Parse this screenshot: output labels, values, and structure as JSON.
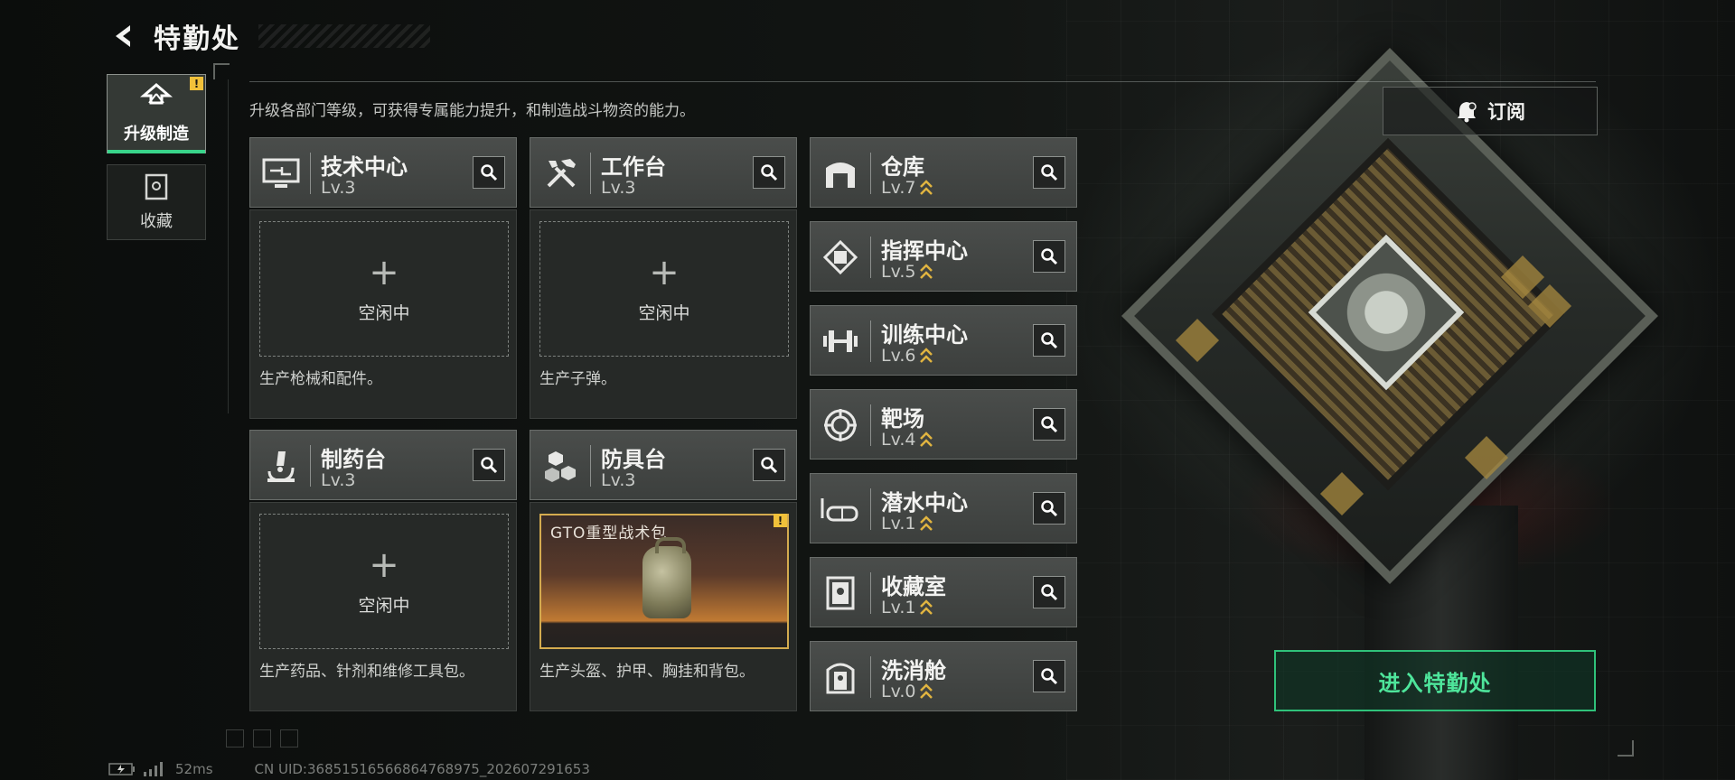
{
  "header": {
    "title": "特勤处",
    "back_icon": "back-arrow-icon"
  },
  "side_tabs": [
    {
      "label": "升级制造",
      "icon": "upgrade-arrow-icon",
      "active": true,
      "badge": "!"
    },
    {
      "label": "收藏",
      "icon": "collection-case-icon",
      "active": false
    }
  ],
  "intro_text": "升级各部门等级，可获得专属能力提升，和制造战斗物资的能力。",
  "production_cards": [
    {
      "name": "技术中心",
      "level": "Lv.3",
      "icon": "monitor-icon",
      "slot_status": "空闲中",
      "slot_plus": "+",
      "desc": "生产枪械和配件。"
    },
    {
      "name": "工作台",
      "level": "Lv.3",
      "icon": "tools-icon",
      "slot_status": "空闲中",
      "slot_plus": "+",
      "desc": "生产子弹。"
    },
    {
      "name": "制药台",
      "level": "Lv.3",
      "icon": "microscope-icon",
      "slot_status": "空闲中",
      "slot_plus": "+",
      "desc": "生产药品、针剂和维修工具包。"
    },
    {
      "name": "防具台",
      "level": "Lv.3",
      "icon": "armor-blocks-icon",
      "product_name": "GTO重型战术包",
      "product_badge": "!",
      "desc": "生产头盔、护甲、胸挂和背包。"
    }
  ],
  "facilities": [
    {
      "name": "仓库",
      "level": "Lv.7",
      "icon": "warehouse-icon",
      "upgradeable": true
    },
    {
      "name": "指挥中心",
      "level": "Lv.5",
      "icon": "chip-icon",
      "upgradeable": true
    },
    {
      "name": "训练中心",
      "level": "Lv.6",
      "icon": "dumbbell-icon",
      "upgradeable": true
    },
    {
      "name": "靶场",
      "level": "Lv.4",
      "icon": "target-icon",
      "upgradeable": true
    },
    {
      "name": "潜水中心",
      "level": "Lv.1",
      "icon": "diving-mask-icon",
      "upgradeable": true
    },
    {
      "name": "收藏室",
      "level": "Lv.1",
      "icon": "display-case-icon",
      "upgradeable": true
    },
    {
      "name": "洗消舱",
      "level": "Lv.0",
      "icon": "decon-pod-icon",
      "upgradeable": true
    }
  ],
  "subscribe_button": {
    "label": "订阅",
    "icon": "bell-icon"
  },
  "enter_button": {
    "label": "进入特勤处"
  },
  "status_bar": {
    "ping": "52ms",
    "uid": "CN UID:3685151656686476897​5_202607291653"
  },
  "colors": {
    "accent_green": "#2fc27a",
    "warning_yellow": "#f1c13a",
    "upgrade_gold": "#e0b440"
  }
}
